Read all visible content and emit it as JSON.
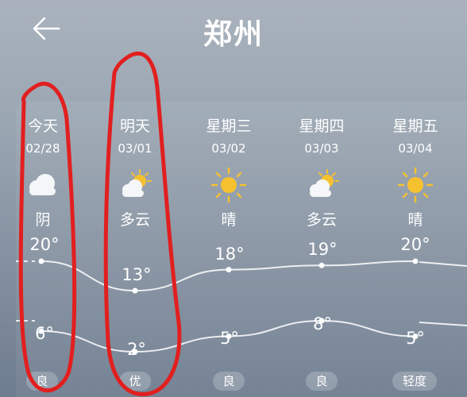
{
  "header": {
    "title": "郑州",
    "back_icon": "back-arrow-icon"
  },
  "forecast": [
    {
      "day": "今天",
      "date": "02/28",
      "icon": "cloudy-icon",
      "condition": "阴",
      "high": "20°",
      "low": "6°",
      "air": "良"
    },
    {
      "day": "明天",
      "date": "03/01",
      "icon": "partly-cloudy-icon",
      "condition": "多云",
      "high": "13°",
      "low": "2°",
      "air": "优"
    },
    {
      "day": "星期三",
      "date": "03/02",
      "icon": "sunny-icon",
      "condition": "晴",
      "high": "18°",
      "low": "5°",
      "air": "良"
    },
    {
      "day": "星期四",
      "date": "03/03",
      "icon": "partly-cloudy-icon",
      "condition": "多云",
      "high": "19°",
      "low": "8°",
      "air": "良"
    },
    {
      "day": "星期五",
      "date": "03/04",
      "icon": "sunny-icon",
      "condition": "晴",
      "high": "20°",
      "low": "5°",
      "air": "轻度"
    }
  ],
  "temps": {
    "high": [
      20,
      13,
      18,
      19,
      20
    ],
    "low": [
      6,
      2,
      5,
      8,
      5
    ]
  }
}
